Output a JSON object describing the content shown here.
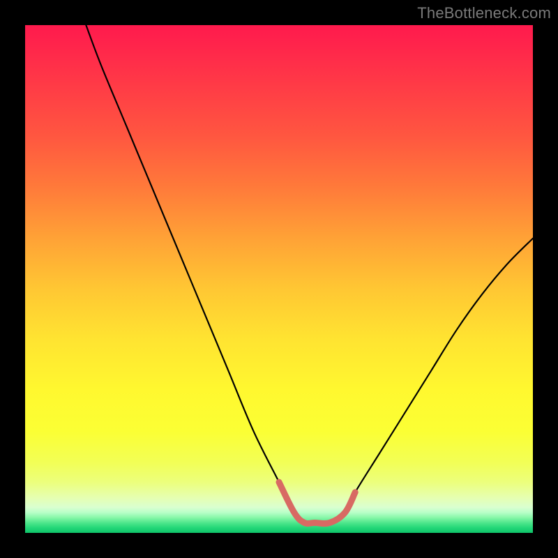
{
  "watermark": "TheBottleneck.com",
  "colors": {
    "frame_bg": "#000000",
    "curve_main": "#000000",
    "curve_bottom_highlight": "#d86a63"
  },
  "chart_data": {
    "type": "line",
    "title": "",
    "xlabel": "",
    "ylabel": "",
    "xlim": [
      0,
      100
    ],
    "ylim": [
      0,
      100
    ],
    "series": [
      {
        "name": "bottleneck-curve",
        "x": [
          12,
          15,
          20,
          25,
          30,
          35,
          40,
          45,
          50,
          53,
          55,
          57,
          60,
          63,
          65,
          70,
          75,
          80,
          85,
          90,
          95,
          100
        ],
        "values": [
          100,
          92,
          80,
          68,
          56,
          44,
          32,
          20,
          10,
          4,
          2,
          2,
          2,
          4,
          8,
          16,
          24,
          32,
          40,
          47,
          53,
          58
        ]
      }
    ],
    "annotations": [
      {
        "name": "highlight-valley",
        "type": "segment",
        "x_range": [
          50,
          65
        ],
        "color": "#d86a63"
      }
    ]
  }
}
